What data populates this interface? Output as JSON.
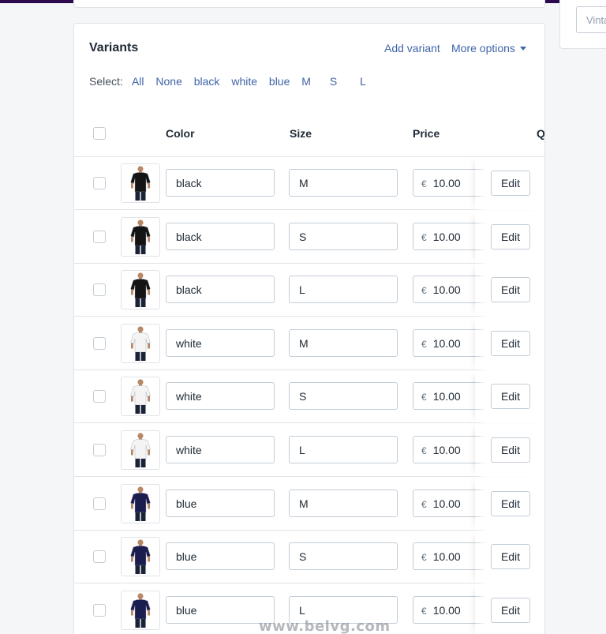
{
  "side": {
    "input_value": "Vintage"
  },
  "variants": {
    "title": "Variants",
    "add_variant": "Add variant",
    "more_options": "More options",
    "select_label": "Select:",
    "select_options": [
      "All",
      "None",
      "black",
      "white",
      "blue",
      "M",
      "S",
      "L"
    ],
    "columns": {
      "color": "Color",
      "size": "Size",
      "price": "Price",
      "quantity": "Q"
    },
    "currency": "€",
    "edit_label": "Edit",
    "rows": [
      {
        "color": "black",
        "size": "M",
        "price": "10.00",
        "shirt_color": "#141414"
      },
      {
        "color": "black",
        "size": "S",
        "price": "10.00",
        "shirt_color": "#141414"
      },
      {
        "color": "black",
        "size": "L",
        "price": "10.00",
        "shirt_color": "#141414"
      },
      {
        "color": "white",
        "size": "M",
        "price": "10.00",
        "shirt_color": "#f4f4f4"
      },
      {
        "color": "white",
        "size": "S",
        "price": "10.00",
        "shirt_color": "#f4f4f4"
      },
      {
        "color": "white",
        "size": "L",
        "price": "10.00",
        "shirt_color": "#f4f4f4"
      },
      {
        "color": "blue",
        "size": "M",
        "price": "10.00",
        "shirt_color": "#1c1d4f"
      },
      {
        "color": "blue",
        "size": "S",
        "price": "10.00",
        "shirt_color": "#1c1d4f"
      },
      {
        "color": "blue",
        "size": "L",
        "price": "10.00",
        "shirt_color": "#1c1d4f"
      }
    ]
  },
  "watermark": "www.belvg.com",
  "colors": {
    "link": "#3f64a8",
    "topbar": "#2b0a4f",
    "border": "#dfe3e8"
  }
}
